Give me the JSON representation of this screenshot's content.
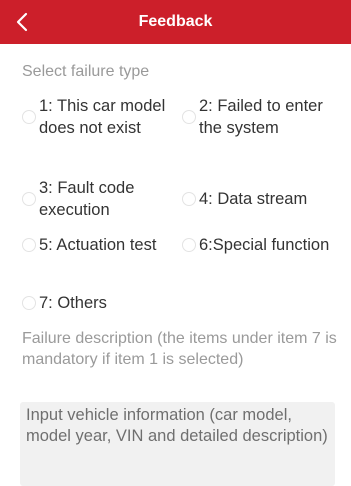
{
  "header": {
    "title": "Feedback",
    "back_icon": "chevron-left-icon",
    "bg_color": "#cc1f2a"
  },
  "failure_type": {
    "label": "Select failure type",
    "options": [
      {
        "label": "1: This car model does not exist"
      },
      {
        "label": "2: Failed to enter the system"
      },
      {
        "label": "3: Fault code execution"
      },
      {
        "label": "4: Data stream"
      },
      {
        "label": "5: Actuation test"
      },
      {
        "label": "6:Special function"
      },
      {
        "label": "7: Others"
      }
    ]
  },
  "failure_description": {
    "label": "Failure description (the items under item 7 is mandatory if item 1 is selected)",
    "placeholder": "Input vehicle information (car model, model year, VIN and detailed description)"
  }
}
